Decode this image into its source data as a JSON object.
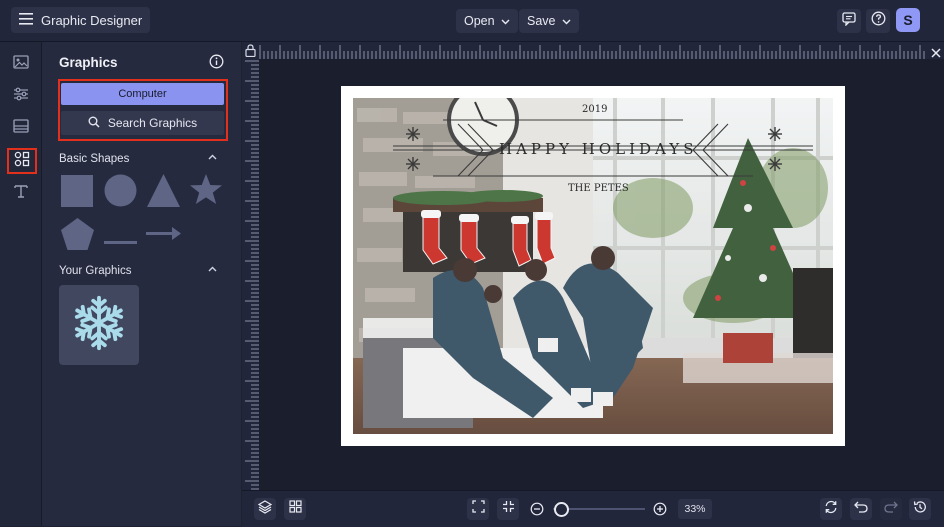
{
  "header": {
    "app_title": "Graphic Designer",
    "open_label": "Open",
    "save_label": "Save",
    "avatar_initial": "S"
  },
  "panel": {
    "title": "Graphics",
    "computer_button": "Computer",
    "search_button": "Search Graphics",
    "basic_shapes_label": "Basic Shapes",
    "your_graphics_label": "Your Graphics"
  },
  "canvas": {
    "year": "2019",
    "greeting": "HAPPY HOLIDAYS",
    "signature": "THE PETES"
  },
  "footer": {
    "zoom_value": "33%"
  },
  "colors": {
    "accent": "#8b93f0",
    "highlight": "#e2301c",
    "background": "#1e2130"
  },
  "icons": {
    "menu": "hamburger-icon",
    "comment": "comment-icon",
    "help": "help-icon",
    "close": "close-icon",
    "lock": "lock-icon"
  }
}
